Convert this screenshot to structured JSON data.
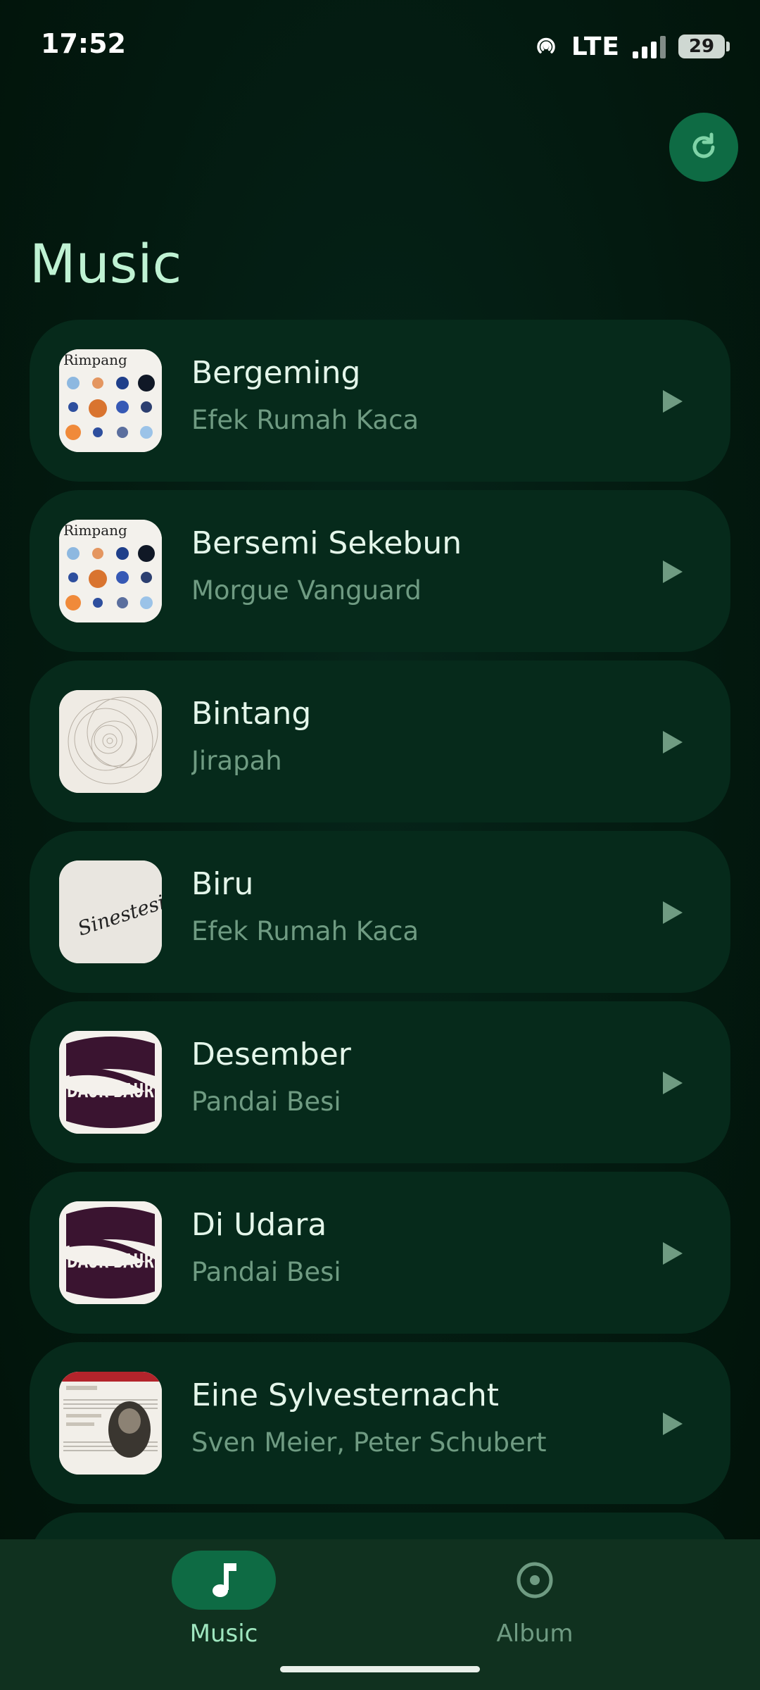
{
  "status_bar": {
    "time": "17:52",
    "network": "LTE",
    "battery": "29"
  },
  "header": {
    "title": "Music",
    "refresh_icon": "refresh-icon"
  },
  "songs": [
    {
      "title": "Bergeming",
      "artist": "Efek Rumah Kaca",
      "art": "rimpang",
      "art_label": "Rimpang"
    },
    {
      "title": "Bersemi Sekebun",
      "artist": "Morgue Vanguard",
      "art": "rimpang",
      "art_label": "Rimpang"
    },
    {
      "title": "Bintang",
      "artist": "Jirapah",
      "art": "circles"
    },
    {
      "title": "Biru",
      "artist": "Efek Rumah Kaca",
      "art": "sinestesia",
      "art_label": "Sinestesia"
    },
    {
      "title": "Desember",
      "artist": "Pandai Besi",
      "art": "daur",
      "art_label": "DAUR BAUR"
    },
    {
      "title": "Di Udara",
      "artist": "Pandai Besi",
      "art": "daur",
      "art_label": "DAUR BAUR"
    },
    {
      "title": "Eine Sylvesternacht",
      "artist": "Sven Meier, Peter Schubert",
      "art": "portrait"
    }
  ],
  "bottom_nav": {
    "items": [
      {
        "label": "Music",
        "icon": "music-note-icon",
        "selected": true
      },
      {
        "label": "Album",
        "icon": "album-disc-icon",
        "selected": false
      }
    ]
  },
  "colors": {
    "background": "#031a10",
    "card": "#062a1b",
    "accent": "#0e6b44",
    "title": "#bff2d3",
    "subtitle": "#6f9b82"
  }
}
